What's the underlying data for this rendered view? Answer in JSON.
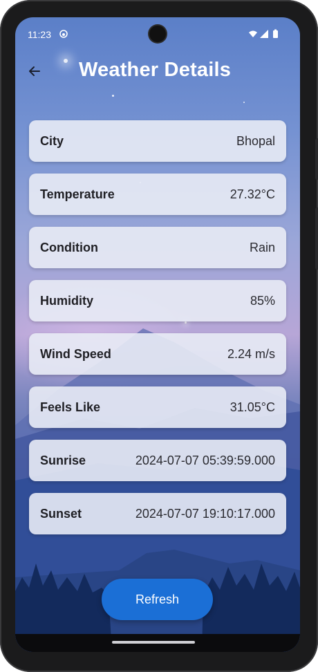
{
  "status": {
    "time": "11:23",
    "icons": [
      "wifi-icon",
      "signal-icon",
      "battery-icon"
    ]
  },
  "header": {
    "back_icon": "arrow-left-icon",
    "title": "Weather Details"
  },
  "details": [
    {
      "label": "City",
      "value": "Bhopal"
    },
    {
      "label": "Temperature",
      "value": "27.32°C"
    },
    {
      "label": "Condition",
      "value": "Rain"
    },
    {
      "label": "Humidity",
      "value": "85%"
    },
    {
      "label": "Wind Speed",
      "value": "2.24 m/s"
    },
    {
      "label": "Feels Like",
      "value": "31.05°C"
    },
    {
      "label": "Sunrise",
      "value": "2024-07-07 05:39:59.000"
    },
    {
      "label": "Sunset",
      "value": "2024-07-07 19:10:17.000"
    }
  ],
  "actions": {
    "refresh_label": "Refresh"
  },
  "colors": {
    "accent": "#1b6fd6",
    "card_background": "#e8ebf5",
    "title_text": "#ffffff"
  }
}
